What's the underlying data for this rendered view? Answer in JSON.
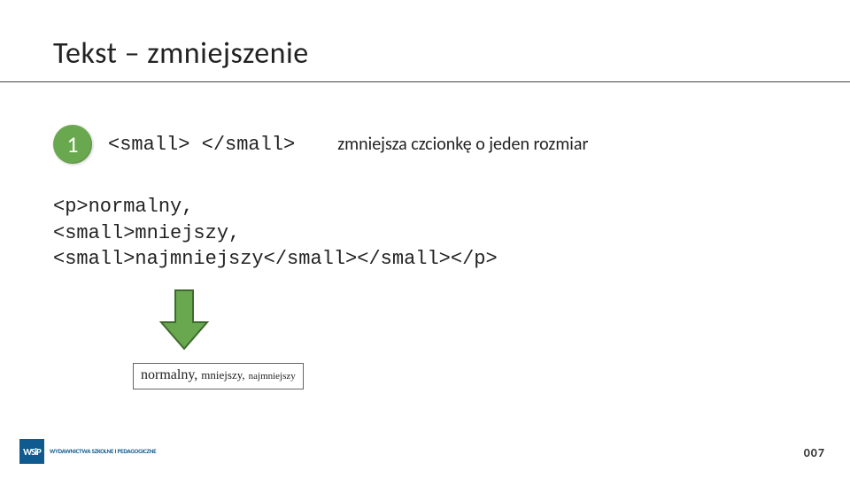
{
  "title": "Tekst – zmniejszenie",
  "badge": "1",
  "tag_code": "<small> </small>",
  "description": "zmniejsza czcionkę o jeden rozmiar",
  "code_example": "<p>normalny,\n<small>mniejszy,\n<small>najmniejszy</small></small></p>",
  "example_output": {
    "w1": "normalny,",
    "w2": "mniejszy,",
    "w3": "najmniejszy"
  },
  "logo_text": "WYDAWNICTWA\nSZKOLNE\nI PEDAGOGICZNE",
  "logo_mark": "WSiP",
  "page_number": "007"
}
